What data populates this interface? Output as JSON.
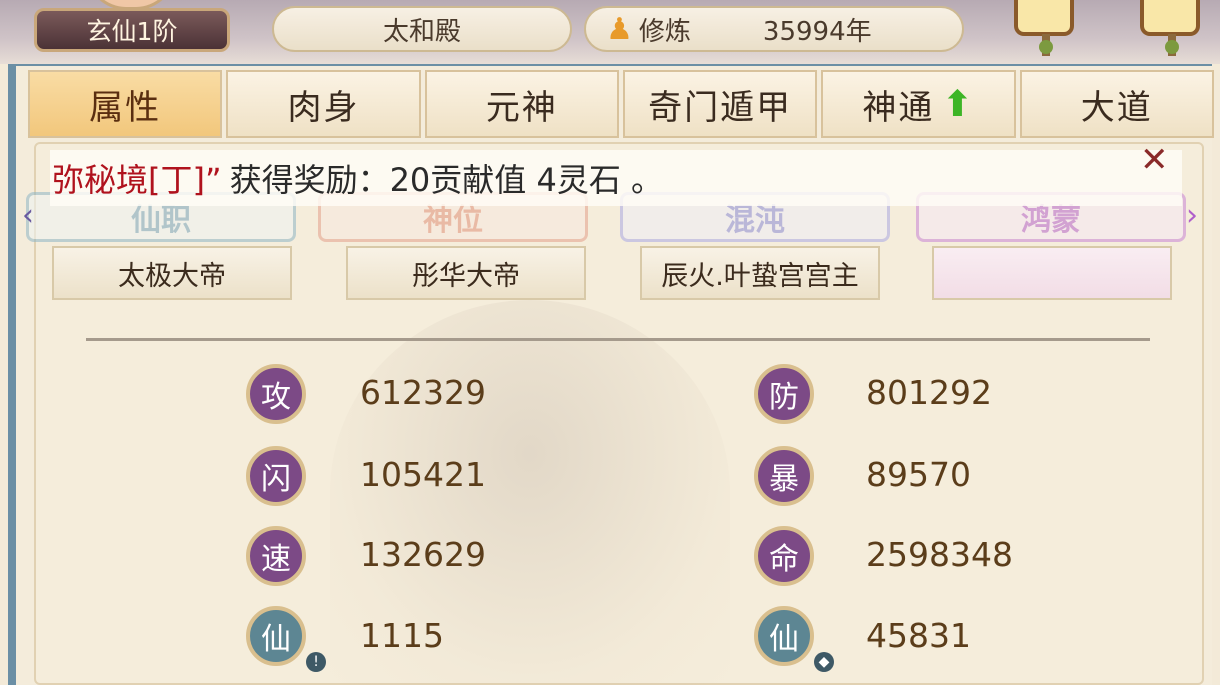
{
  "header": {
    "rank": "玄仙1阶",
    "location": "太和殿",
    "cultivation_label": "修炼",
    "cultivation_years": "35994年"
  },
  "tabs": [
    {
      "label": "属性",
      "active": true
    },
    {
      "label": "肉身",
      "active": false
    },
    {
      "label": "元神",
      "active": false
    },
    {
      "label": "奇门遁甲",
      "active": false
    },
    {
      "label": "神通",
      "active": false,
      "has_up_arrow": true
    },
    {
      "label": "大道",
      "active": false
    }
  ],
  "notice": {
    "highlight": "弥秘境[丁]”",
    "rest": "获得奖励：20贡献值 4灵石 。"
  },
  "titles": {
    "headers": [
      "仙职",
      "神位",
      "混沌",
      "鸿蒙"
    ],
    "values": [
      "太极大帝",
      "彤华大帝",
      "辰火.叶蛰宫宫主",
      ""
    ]
  },
  "stats": [
    {
      "icon": "攻",
      "value": "612329"
    },
    {
      "icon": "防",
      "value": "801292"
    },
    {
      "icon": "闪",
      "value": "105421"
    },
    {
      "icon": "暴",
      "value": "89570"
    },
    {
      "icon": "速",
      "value": "132629"
    },
    {
      "icon": "命",
      "value": "2598348"
    },
    {
      "icon": "仙",
      "value": "1115"
    },
    {
      "icon": "仙",
      "value": "45831"
    }
  ],
  "colors": {
    "accent_red": "#b0121d",
    "stat_purple": "#7c4a86",
    "stat_teal": "#5d8693",
    "tab_active": "#f2c77c"
  }
}
